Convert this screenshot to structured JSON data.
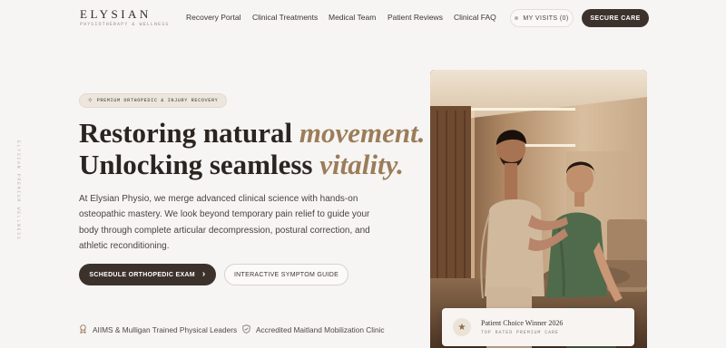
{
  "brand": {
    "name": "ELYSIAN",
    "tagline": "PHYSIOTHERAPY & WELLNESS"
  },
  "nav": {
    "items": [
      {
        "label": "Recovery Portal"
      },
      {
        "label": "Clinical Treatments"
      },
      {
        "label": "Medical Team"
      },
      {
        "label": "Patient Reviews"
      },
      {
        "label": "Clinical FAQ"
      }
    ],
    "visits_label": "MY VISITS (0)",
    "cta_label": "SECURE CARE"
  },
  "side_label": "ELYSIAN PREMIUM WELLNESS",
  "hero": {
    "badge": "PREMIUM ORTHOPEDIC & INJURY RECOVERY",
    "line1_plain": "Restoring natural ",
    "line1_em": "movement.",
    "line2_plain": "Unlocking seamless ",
    "line2_em": "vitality.",
    "lead": "At Elysian Physio, we merge advanced clinical science with hands-on osteopathic mastery. We look beyond temporary pain relief to guide your body through complete articular decompression, postural correction, and athletic reconditioning.",
    "primary_cta": "SCHEDULE ORTHOPEDIC EXAM",
    "primary_arrow": "›",
    "secondary_cta": "INTERACTIVE SYMPTOM GUIDE"
  },
  "trust": [
    {
      "icon": "award-icon",
      "text": "AIIMS & Mulligan Trained Physical Leaders"
    },
    {
      "icon": "shield-check-icon",
      "text": "Accredited Maitland Mobilization Clinic"
    }
  ],
  "award_card": {
    "title": "Patient Choice Winner 2026",
    "subtitle": "TOP RATED PREMIUM CARE",
    "icon": "star-icon"
  },
  "colors": {
    "accent": "#9b7d5a",
    "dark": "#3d322b",
    "background": "#f7f5f3"
  }
}
